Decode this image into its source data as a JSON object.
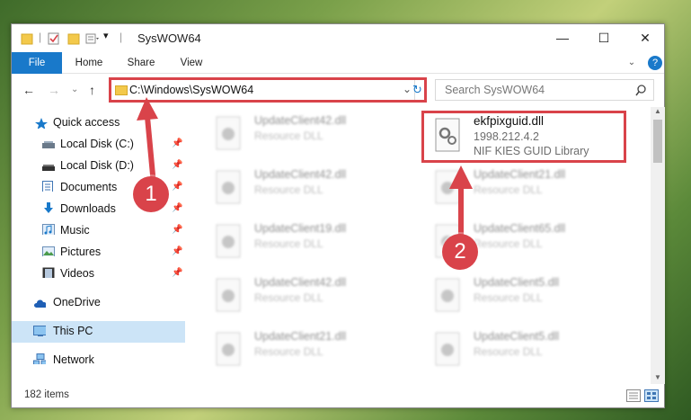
{
  "window": {
    "title": "SysWOW64",
    "controls": {
      "minimize": "—",
      "maximize": "☐",
      "close": "✕"
    }
  },
  "ribbon": {
    "tabs": [
      "File",
      "Home",
      "Share",
      "View"
    ],
    "expand_icon": "chevron-down",
    "help_icon": "?"
  },
  "navigation": {
    "address": "C:\\Windows\\SysWOW64",
    "search_placeholder": "Search SysWOW64"
  },
  "sidebar": {
    "items": [
      {
        "label": "Quick access",
        "icon": "star-icon",
        "pinned": false
      },
      {
        "label": "Local Disk (C:)",
        "icon": "drive-icon",
        "pinned": true
      },
      {
        "label": "Local Disk (D:)",
        "icon": "drive-icon",
        "pinned": true
      },
      {
        "label": "Documents",
        "icon": "documents-icon",
        "pinned": true
      },
      {
        "label": "Downloads",
        "icon": "download-icon",
        "pinned": true
      },
      {
        "label": "Music",
        "icon": "music-icon",
        "pinned": true
      },
      {
        "label": "Pictures",
        "icon": "pictures-icon",
        "pinned": true
      },
      {
        "label": "Videos",
        "icon": "videos-icon",
        "pinned": true
      },
      {
        "label": "OneDrive",
        "icon": "cloud-icon",
        "pinned": false
      },
      {
        "label": "This PC",
        "icon": "computer-icon",
        "pinned": false,
        "selected": true
      },
      {
        "label": "Network",
        "icon": "network-icon",
        "pinned": false
      }
    ]
  },
  "files": {
    "left_column": [
      {
        "name": "UpdateClient42.dll",
        "type": "Resource DLL"
      },
      {
        "name": "UpdateClient42.dll",
        "type": "Resource DLL"
      },
      {
        "name": "UpdateClient19.dll",
        "type": "Resource DLL"
      },
      {
        "name": "UpdateClient42.dll",
        "type": "Resource DLL"
      },
      {
        "name": "UpdateClient21.dll",
        "type": "Resource DLL"
      }
    ],
    "right_column": [
      {
        "name": "UpdateClient21.dll",
        "type": "Resource DLL"
      },
      {
        "name": "UpdateClient65.dll",
        "type": "Resource DLL"
      },
      {
        "name": "UpdateClient5.dll",
        "type": "Resource DLL"
      },
      {
        "name": "UpdateClient5.dll",
        "type": "Resource DLL"
      }
    ],
    "featured": {
      "name": "ekfpixguid.dll",
      "version": "1998.212.4.2",
      "description": "NIF KIES GUID Library"
    }
  },
  "status": {
    "item_count": "182 items"
  },
  "annotations": {
    "step1": "1",
    "step2": "2",
    "color": "#d9434a"
  }
}
